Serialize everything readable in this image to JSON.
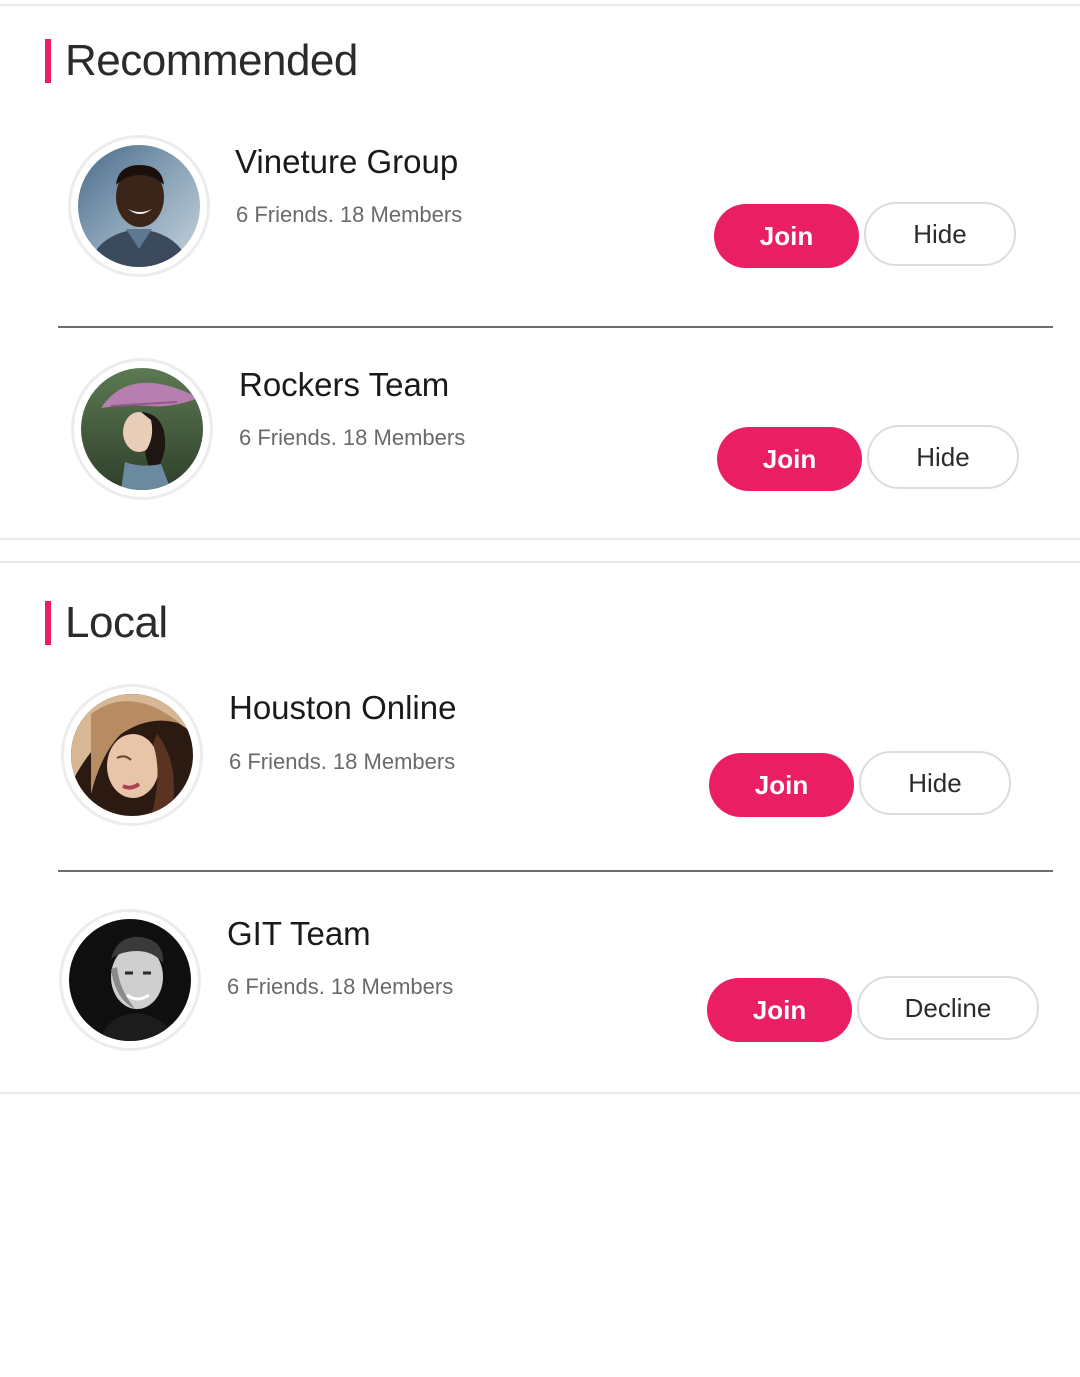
{
  "sections": [
    {
      "title": "Recommended",
      "groups": [
        {
          "name": "Vineture Group",
          "meta": "6 Friends. 18 Members",
          "join_label": "Join",
          "secondary_label": "Hide"
        },
        {
          "name": "Rockers Team",
          "meta": "6 Friends. 18 Members",
          "join_label": "Join",
          "secondary_label": "Hide"
        }
      ]
    },
    {
      "title": "Local",
      "groups": [
        {
          "name": "Houston Online",
          "meta": "6 Friends. 18 Members",
          "join_label": "Join",
          "secondary_label": "Hide"
        },
        {
          "name": "GIT Team",
          "meta": "6 Friends. 18 Members",
          "join_label": "Join",
          "secondary_label": "Decline"
        }
      ]
    }
  ],
  "colors": {
    "accent": "#e91e63",
    "divider": "#6e6e6e",
    "border": "#dcdcdc"
  }
}
